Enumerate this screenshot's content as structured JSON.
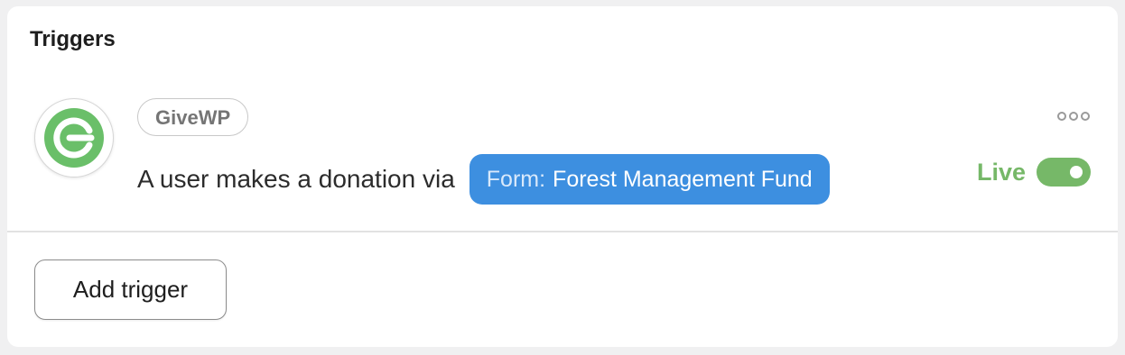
{
  "section": {
    "title": "Triggers"
  },
  "trigger": {
    "integration_icon": "givewp-logo-icon",
    "integration_name": "GiveWP",
    "description": "A user makes a donation via",
    "form_prefix": "Form:",
    "form_name": "Forest Management Fund",
    "status_label": "Live",
    "enabled": true,
    "more_icon": "ellipsis-icon"
  },
  "actions": {
    "add_trigger_label": "Add trigger"
  },
  "colors": {
    "accent_blue": "#3d8fe0",
    "live_green": "#76b868",
    "givewp_green": "#6abf69"
  }
}
